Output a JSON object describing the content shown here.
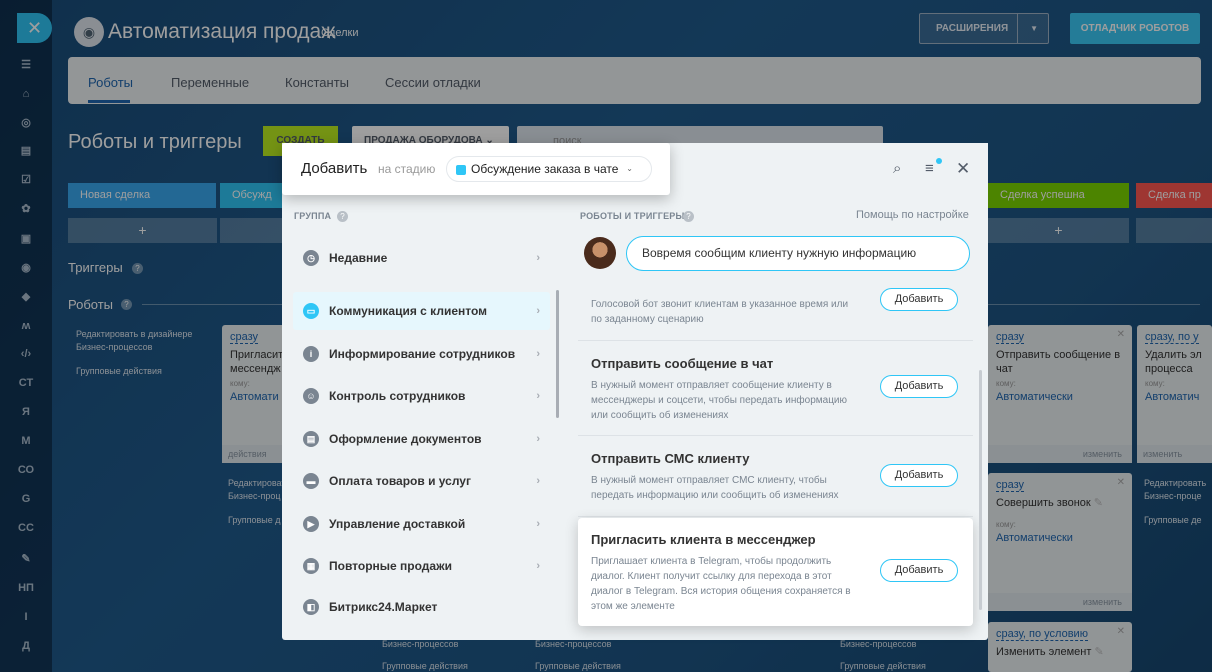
{
  "header": {
    "title": "Автоматизация продаж",
    "subtitle": "Сделки",
    "extensions_label": "РАСШИРЕНИЯ",
    "debugger_label": "ОТЛАДЧИК РОБОТОВ"
  },
  "rail": {
    "items": [
      "СТ",
      "Я",
      "М",
      "СО",
      "G",
      "СС",
      "НП",
      "I",
      "Д"
    ]
  },
  "tabs": [
    "Роботы",
    "Переменные",
    "Константы",
    "Сессии отладки"
  ],
  "page": {
    "title": "Роботы и триггеры",
    "create_label": "СОЗДАТЬ",
    "pipeline_label": "ПРОДАЖА ОБОРУДОВА",
    "search_placeholder": "поиск"
  },
  "stages": [
    {
      "label": "Новая сделка",
      "color": "#39a8ef"
    },
    {
      "label": "Обсужд",
      "color": "#2fc6f6"
    },
    {
      "label": "Сделка успешна",
      "color": "#7bd500"
    },
    {
      "label": "Сделка пр",
      "color": "#ff5752"
    }
  ],
  "stage_add": "+",
  "sections": {
    "triggers": "Триггеры",
    "robots": "Роботы"
  },
  "side_links": {
    "designer": "Редактировать в дизайнере Бизнес-процессов",
    "group": "Групповые действия",
    "designer_short_a": "Редактировать в дизайнере",
    "designer_short_b": "Бизнес-проц",
    "group_short": "Групповые д",
    "designer_right_a": "Редактировать",
    "designer_right_b": "Бизнес-проце",
    "group_right": "Групповые де"
  },
  "cards": {
    "left": {
      "when": "сразу",
      "name_a": "Пригласит",
      "name_b": "мессендж",
      "who": "кому:",
      "auto": "Автомати",
      "foot": "действия"
    },
    "r1": {
      "when": "сразу",
      "name": "Отправить сообщение в чат",
      "who": "кому:",
      "auto": "Автоматически",
      "foot": "изменить"
    },
    "r2": {
      "when": "сразу",
      "name": "Совершить звонок",
      "who": "кому:",
      "auto": "Автоматически",
      "foot": "изменить"
    },
    "r3": {
      "when": "сразу, по условию",
      "name": "Изменить элемент"
    },
    "far1": {
      "when": "сразу, по у",
      "name_a": "Удалить эл",
      "name_b": "процесса",
      "who": "кому:",
      "auto": "Автоматич",
      "foot": "изменить"
    }
  },
  "bottom_texts": {
    "bp_a": "Бизнес-процессов",
    "gd_a": "Групповые действия",
    "bp_b": "Бизнес-процессов",
    "gd_b": "Групповые действия",
    "bp_c": "Бизнес-процессов",
    "gd_c": "Групповые действия"
  },
  "modal": {
    "add_label": "Добавить",
    "on_stage": "на стадию",
    "stage_selected": "Обсуждение заказа в чате",
    "stage_color": "#2fc6f6",
    "group_title": "ГРУППА",
    "robots_title": "РОБОТЫ И ТРИГГЕРЫ",
    "help_link": "Помощь по настройке",
    "bubble_text": "Вовремя сообщим клиенту нужную информацию",
    "groups": [
      {
        "label": "Недавние",
        "icon": "clock-icon"
      },
      {
        "label": "Коммуникация с клиентом",
        "icon": "chat-icon"
      },
      {
        "label": "Информирование сотрудников",
        "icon": "info-icon"
      },
      {
        "label": "Контроль сотрудников",
        "icon": "people-icon"
      },
      {
        "label": "Оформление документов",
        "icon": "document-icon"
      },
      {
        "label": "Оплата товаров и услуг",
        "icon": "wallet-icon"
      },
      {
        "label": "Управление доставкой",
        "icon": "truck-icon"
      },
      {
        "label": "Повторные продажи",
        "icon": "cart-icon"
      },
      {
        "label": "Битрикс24.Маркет",
        "icon": "market-icon"
      }
    ],
    "robots": [
      {
        "title": "",
        "desc": "Голосовой бот звонит клиентам в указанное время или по заданному сценарию",
        "button": "Добавить"
      },
      {
        "title": "Отправить сообщение в чат",
        "desc": "В нужный момент отправляет сообщение клиенту в мессенджеры и соцсети, чтобы передать информацию или сообщить об изменениях",
        "button": "Добавить"
      },
      {
        "title": "Отправить СМС клиенту",
        "desc": "В нужный момент отправляет СМС клиенту, чтобы передать информацию или сообщить об изменениях",
        "button": "Добавить"
      },
      {
        "title": "Пригласить клиента в мессенджер",
        "desc": "Приглашает клиента в Telegram, чтобы продолжить диалог. Клиент получит ссылку для перехода в этот диалог в Telegram. Вся история общения сохраняется в этом же элементе",
        "button": "Добавить"
      }
    ]
  }
}
